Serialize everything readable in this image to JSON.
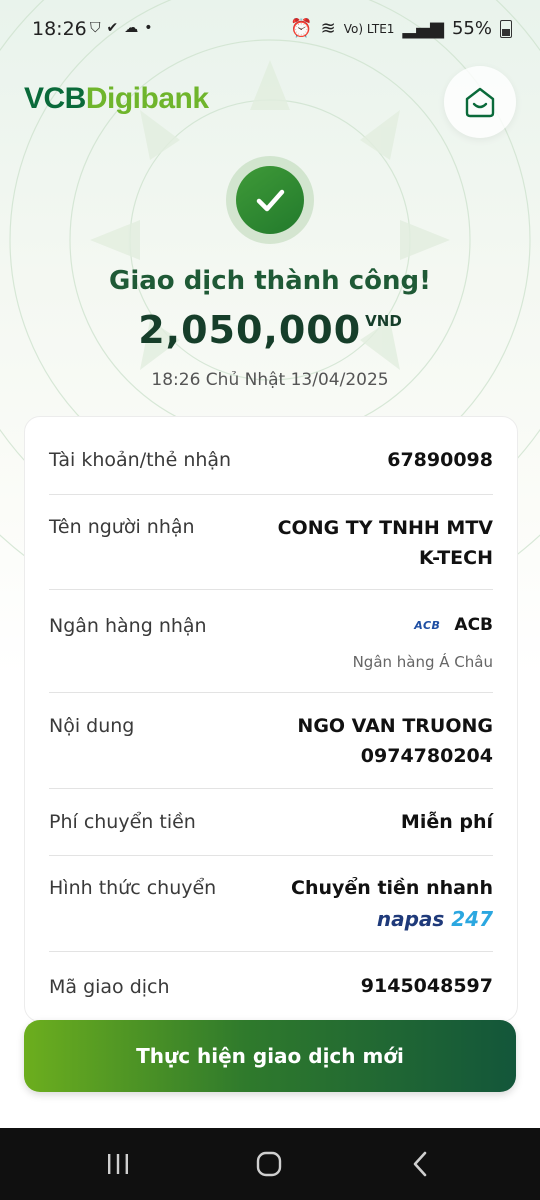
{
  "status_bar": {
    "time": "18:26",
    "network_label": "Vo) LTE1",
    "battery": "55%"
  },
  "header": {
    "logo_part1": "VCB",
    "logo_part2": "Digibank",
    "home_icon": "smile-home-icon"
  },
  "result": {
    "title": "Giao dịch thành công!",
    "amount": "2,050,000",
    "currency": "VND",
    "datetime": "18:26 Chủ Nhật 13/04/2025"
  },
  "details": {
    "account": {
      "label": "Tài khoản/thẻ nhận",
      "value": "67890098"
    },
    "receiver": {
      "label": "Tên người nhận",
      "value_line1": "CONG TY TNHH MTV",
      "value_line2": "K-TECH"
    },
    "bank": {
      "label": "Ngân hàng nhận",
      "logo_text": "ACB",
      "code": "ACB",
      "full_name": "Ngân hàng Á Châu"
    },
    "content": {
      "label": "Nội dung",
      "value_line1": "NGO VAN TRUONG",
      "value_line2": "0974780204"
    },
    "fee": {
      "label": "Phí chuyển tiền",
      "value": "Miễn phí"
    },
    "method": {
      "label": "Hình thức chuyển",
      "value": "Chuyển tiền nhanh",
      "napas_part1": "napas",
      "napas_part2": "247"
    },
    "transaction_id": {
      "label": "Mã giao dịch",
      "value": "9145048597"
    }
  },
  "action": {
    "label": "Thực hiện giao dịch mới"
  },
  "colors": {
    "brand_dark": "#0a6a3a",
    "brand_light": "#6fb52c",
    "success": "#2e8b34"
  }
}
